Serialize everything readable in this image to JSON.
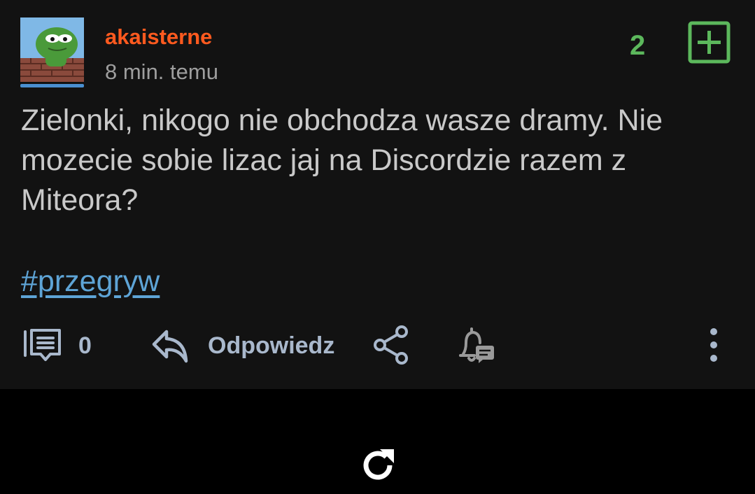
{
  "post": {
    "author": "akaisterne",
    "time_ago": "8 min. temu",
    "vote_count": "2",
    "body": "Zielonki, nikogo nie obchodza wasze dramy. Nie mozecie sobie lizac jaj na Discordzie razem z Miteora?",
    "tag": "#przegryw"
  },
  "actions": {
    "comment_count": "0",
    "reply_label": "Odpowiedz"
  },
  "icons": {
    "plus": "plus-square-icon",
    "comments": "comment-icon",
    "reply": "reply-arrow-icon",
    "share": "share-icon",
    "bell": "bell-message-icon",
    "more": "more-vertical-icon",
    "refresh": "refresh-icon"
  },
  "colors": {
    "background": "#121212",
    "username": "#ff5a1f",
    "vote": "#5cb85c",
    "tag_link": "#5ea4d6",
    "action_text": "#a9b8cc"
  }
}
